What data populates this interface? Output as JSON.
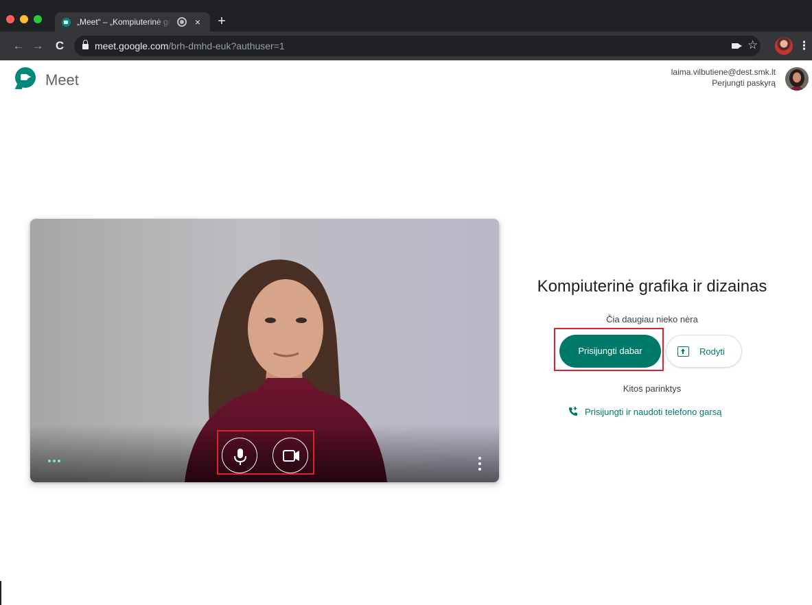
{
  "browser": {
    "tab_title": "„Meet“ – „Kompiuterinė grafika ir dizainas“",
    "tab_close": "×",
    "new_tab": "+",
    "back": "←",
    "forward": "→",
    "reload": "C",
    "url_host": "meet.google.com",
    "url_path": "/brh-dmhd-euk?authuser=1",
    "bookmark_star": "☆",
    "menu": "⋮"
  },
  "header": {
    "product_name": "Meet",
    "account_email": "laima.vilbutiene@dest.smk.lt",
    "switch_account": "Perjungti paskyrą"
  },
  "preview": {
    "more_dots": "...",
    "kebab": "⋮"
  },
  "join_panel": {
    "meeting_title": "Kompiuterinė grafika ir dizainas",
    "status": "Čia daugiau nieko nėra",
    "join_button": "Prisijungti dabar",
    "present_button": "Rodyti",
    "other_options": "Kitos parinktys",
    "phone_link": "Prisijungti ir naudoti telefono garsą"
  },
  "colors": {
    "accent": "#00796b",
    "highlight": "#e1202b",
    "chrome_dark": "#202124"
  }
}
